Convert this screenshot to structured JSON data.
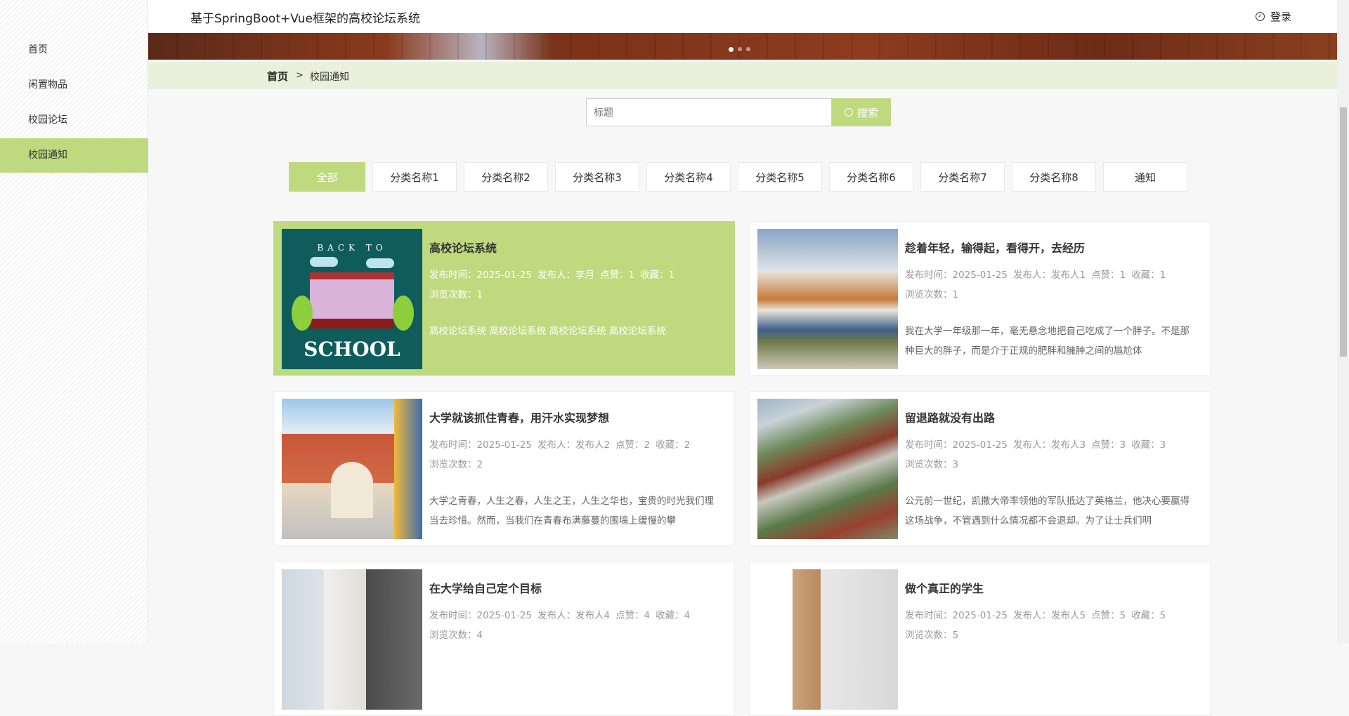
{
  "header": {
    "title": "基于SpringBoot+Vue框架的高校论坛系统",
    "login": "登录"
  },
  "sidebar": {
    "items": [
      {
        "label": "首页"
      },
      {
        "label": "闲置物品"
      },
      {
        "label": "校园论坛"
      },
      {
        "label": "校园通知"
      }
    ]
  },
  "breadcrumb": {
    "home": "首页",
    "sep": ">",
    "current": "校园通知"
  },
  "search": {
    "placeholder": "标题",
    "value": "",
    "button": "搜索"
  },
  "tabs": [
    "全部",
    "分类名称1",
    "分类名称2",
    "分类名称3",
    "分类名称4",
    "分类名称5",
    "分类名称6",
    "分类名称7",
    "分类名称8",
    "通知"
  ],
  "school_image": {
    "top": "BACK TO",
    "bottom": "SCHOOL"
  },
  "colors": {
    "accent": "#bfd97f",
    "crumb_bg": "#ebf0dd"
  },
  "cards": [
    {
      "title": "高校论坛系统",
      "time": "发布时间：2025-01-25",
      "author": "发布人：李月",
      "likes": "点赞：1",
      "favs": "收藏：1",
      "views": "浏览次数：1",
      "desc": "高校论坛系统 高校论坛系统 高校论坛系统 高校论坛系统"
    },
    {
      "title": "趁着年轻，输得起，看得开，去经历",
      "time": "发布时间：2025-01-25",
      "author": "发布人：发布人1",
      "likes": "点赞：1",
      "favs": "收藏：1",
      "views": "浏览次数：1",
      "desc": "我在大学一年级那一年，毫无悬念地把自己吃成了一个胖子。不是那种巨大的胖子，而是介于正规的肥胖和臃肿之间的尴尬体"
    },
    {
      "title": "大学就该抓住青春，用汗水实现梦想",
      "time": "发布时间：2025-01-25",
      "author": "发布人：发布人2",
      "likes": "点赞：2",
      "favs": "收藏：2",
      "views": "浏览次数：2",
      "desc": "大学之青春，人生之春，人生之王，人生之华也，宝贵的时光我们理当去珍惜。然而，当我们在青春布满藤蔓的围墙上缓慢的攀"
    },
    {
      "title": "留退路就没有出路",
      "time": "发布时间：2025-01-25",
      "author": "发布人：发布人3",
      "likes": "点赞：3",
      "favs": "收藏：3",
      "views": "浏览次数：3",
      "desc": "公元前一世纪，凯撒大帝率领他的军队抵达了英格兰，他决心要赢得这场战争，不管遇到什么情况都不会退却。为了让士兵们明"
    },
    {
      "title": "在大学给自己定个目标",
      "time": "发布时间：2025-01-25",
      "author": "发布人：发布人4",
      "likes": "点赞：4",
      "favs": "收藏：4",
      "views": "浏览次数：4",
      "desc": ""
    },
    {
      "title": "做个真正的学生",
      "time": "发布时间：2025-01-25",
      "author": "发布人：发布人5",
      "likes": "点赞：5",
      "favs": "收藏：5",
      "views": "浏览次数：5",
      "desc": ""
    }
  ]
}
